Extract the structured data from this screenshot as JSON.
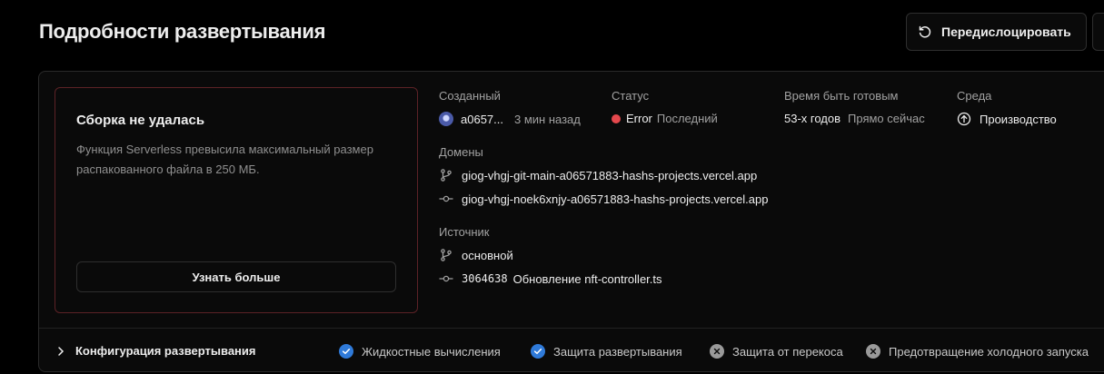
{
  "header": {
    "title": "Подробности развертывания",
    "redeploy_label": "Передислоцировать"
  },
  "error": {
    "title": "Сборка не удалась",
    "description": "Функция Serverless превысила максимальный размер распакованного файла в 250 МБ.",
    "learn_more": "Узнать больше"
  },
  "info": {
    "created_label": "Созданный",
    "created_author": "a0657...",
    "created_time": "3 мин назад",
    "status_label": "Статус",
    "status_value": "Error",
    "status_tag": "Последний",
    "ready_label": "Время быть готовым",
    "ready_value": "53-х годов",
    "ready_when": "Прямо сейчас",
    "env_label": "Среда",
    "env_value": "Производство",
    "domains_label": "Домены",
    "domain_1": "giog-vhgj-git-main-a06571883-hashs-projects.vercel.app",
    "domain_2": "giog-vhgj-noek6xnjy-a06571883-hashs-projects.vercel.app",
    "source_label": "Источник",
    "source_branch": "основной",
    "commit_hash": "3064638",
    "commit_message": "Обновление nft-controller.ts"
  },
  "footer": {
    "config_label": "Конфигурация развертывания",
    "features": [
      {
        "label": "Жидкостные вычисления",
        "enabled": true
      },
      {
        "label": "Защита развертывания",
        "enabled": true
      },
      {
        "label": "Защита от перекоса",
        "enabled": false
      },
      {
        "label": "Предотвращение холодного запуска",
        "enabled": false
      }
    ]
  },
  "colors": {
    "error_dot": "#e5484d",
    "enabled_chip": "#2f7ad9",
    "disabled_chip": "#9a9a9a",
    "error_border": "#5c2226"
  }
}
